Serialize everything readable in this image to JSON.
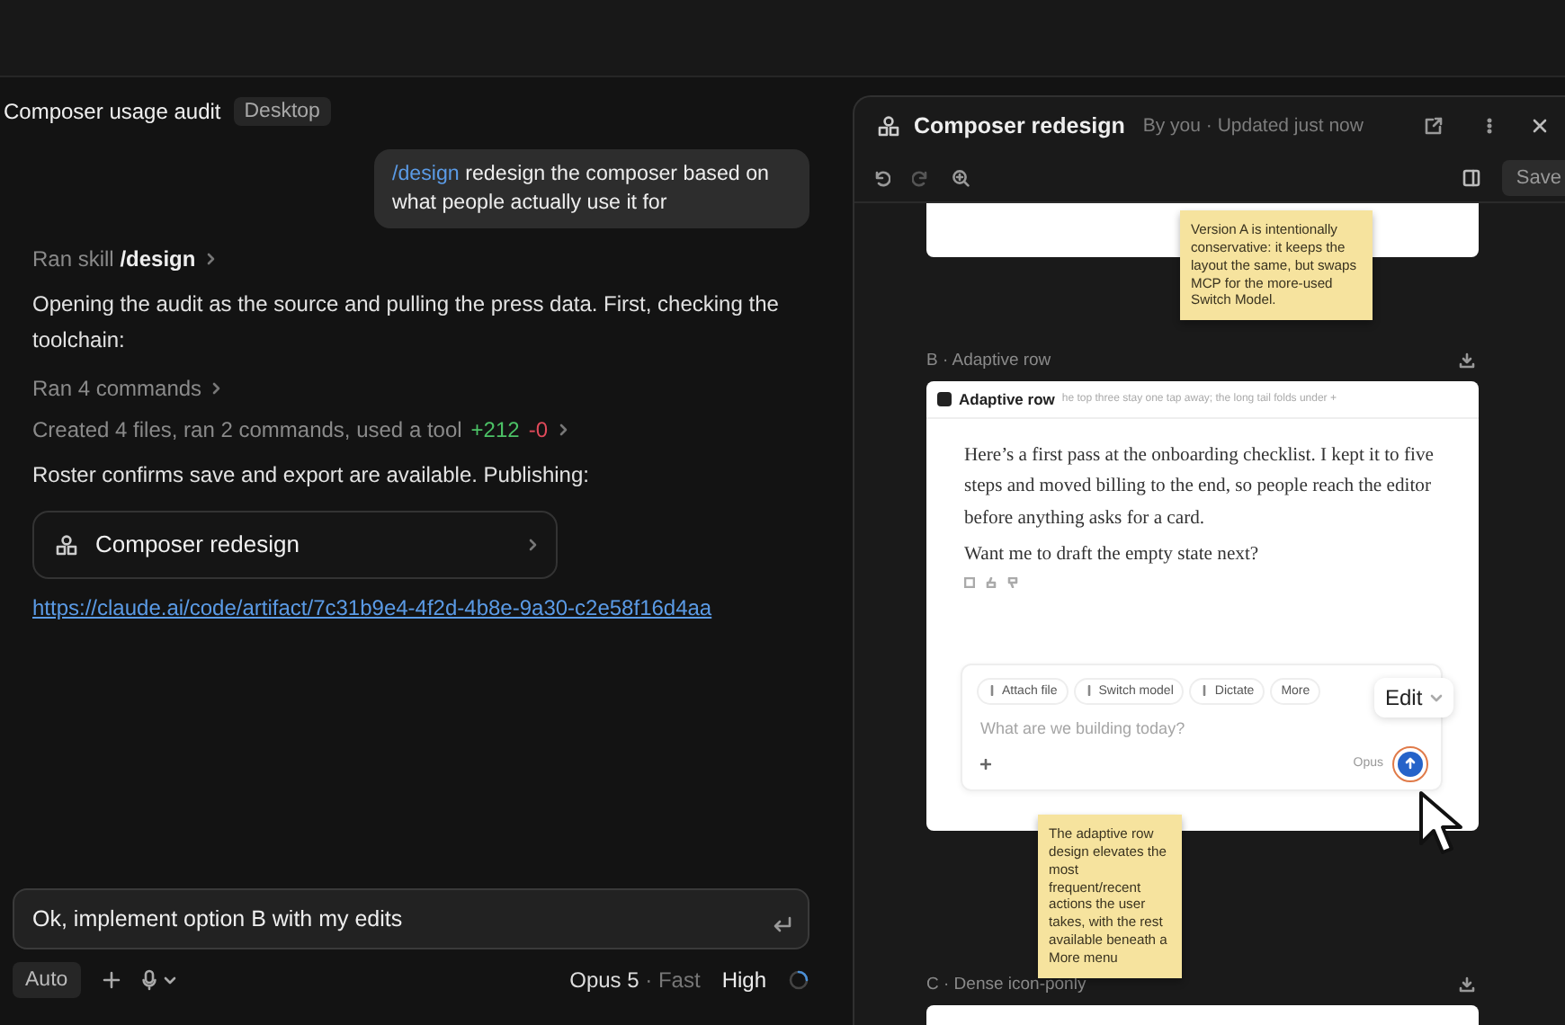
{
  "window": {
    "title": "Composer usage audit",
    "badge": "Desktop"
  },
  "chat": {
    "user_message": {
      "command": "/design",
      "text": "redesign the composer based on what people actually use it for"
    },
    "steps": [
      {
        "kind": "tool",
        "text": "Ran skill **/design**"
      },
      {
        "kind": "text",
        "text": "Opening the audit as the source and pulling the press data. First, checking the toolchain:"
      },
      {
        "kind": "tool",
        "text": "Ran 4 commands"
      },
      {
        "kind": "diff",
        "text": "Created 4 files, ran 2 commands, used a tool",
        "added": "+212",
        "removed": "-0"
      },
      {
        "kind": "text",
        "text": "Roster confirms save and export are available. Publishing:"
      },
      {
        "kind": "artifact",
        "text": "Composer redesign"
      },
      {
        "kind": "link",
        "text": "https://claude.ai/code/artifact/7c31b9e4-4f2d-4b8e-9a30-c2e58f16d4aa"
      }
    ],
    "composer": {
      "value": "Ok, implement option B with my edits",
      "mode": "Auto",
      "model": "Opus 5",
      "speed": "· Fast",
      "effort": "High"
    }
  },
  "artifact": {
    "title": "Composer redesign",
    "meta": "By you · Updated just now",
    "save": "Save",
    "sections": [
      {
        "kind": "cropped_top"
      },
      {
        "kind": "full",
        "label": "B · Adaptive row",
        "card": {
          "title": "Adaptive row",
          "subtitle": "he top three stay one tap away; the long tail folds under +",
          "paragraphs": [
            "Here’s a first pass at the onboarding checklist. I kept it to five steps and moved billing to the end, so people reach the editor before anything asks for a card.",
            "Want me to draft the empty state next?"
          ],
          "chips": [
            "Attach file",
            "Switch model",
            "Dictate",
            "More"
          ],
          "placeholder": "What are we building today?",
          "model": "Opus",
          "send_selected": true
        }
      },
      {
        "kind": "cropped_bottom",
        "label": "C · Dense icon-ponly"
      }
    ],
    "notes": [
      {
        "text": "Version A is intentionally conservative: it keeps the layout the same, but swaps MCP for the more-used Switch Model."
      },
      {
        "text": "The adaptive row design elevates the most frequent/recent actions the user takes, with the rest available beneath a More menu"
      }
    ],
    "edit_popup": {
      "label": "Edit"
    }
  }
}
